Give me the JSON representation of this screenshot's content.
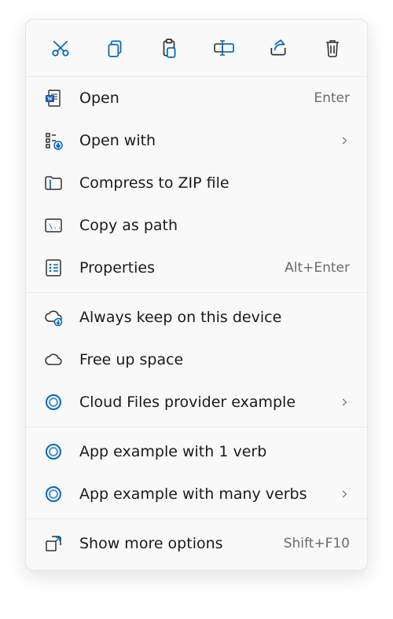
{
  "toolbar": {
    "cut": "Cut",
    "copy": "Copy",
    "paste": "Paste",
    "rename": "Rename",
    "share": "Share",
    "delete": "Delete"
  },
  "sections": {
    "open": {
      "label": "Open",
      "shortcut": "Enter"
    },
    "open_with": {
      "label": "Open with",
      "has_submenu": true
    },
    "compress_zip": {
      "label": "Compress to ZIP file"
    },
    "copy_as_path": {
      "label": "Copy as path"
    },
    "properties": {
      "label": "Properties",
      "shortcut": "Alt+Enter"
    },
    "always_keep": {
      "label": "Always keep on this device"
    },
    "free_up": {
      "label": "Free up space"
    },
    "cloud_provider": {
      "label": "Cloud Files provider example",
      "has_submenu": true
    },
    "app_1verb": {
      "label": "App example with 1 verb"
    },
    "app_manyverb": {
      "label": "App example with many verbs",
      "has_submenu": true
    },
    "show_more": {
      "label": "Show more options",
      "shortcut": "Shift+F10"
    }
  },
  "colors": {
    "accent": "#0067c0",
    "icon_stroke": "#303030"
  }
}
